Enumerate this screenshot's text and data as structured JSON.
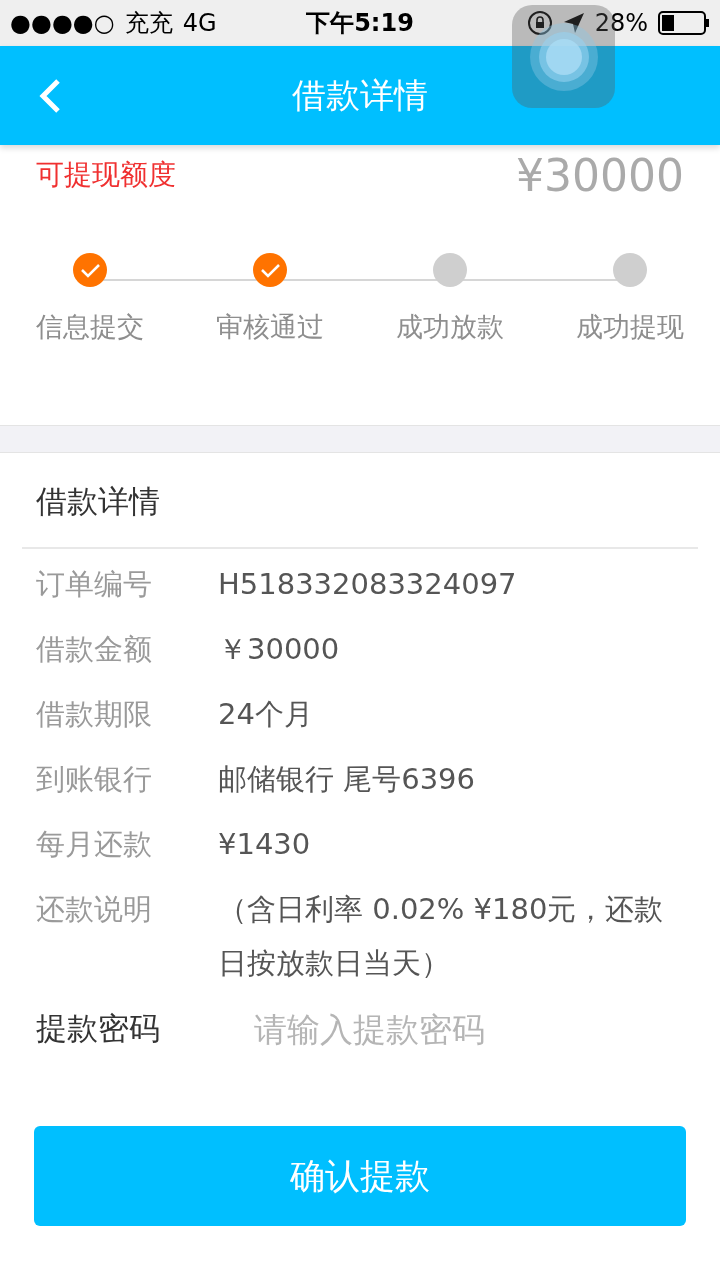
{
  "status_bar": {
    "signal": "●●●●○",
    "carrier": "充充",
    "network": "4G",
    "time": "下午5:19",
    "battery": "28%"
  },
  "header": {
    "title": "借款详情"
  },
  "quota": {
    "label": "可提现额度",
    "amount": "¥30000"
  },
  "steps": [
    {
      "label": "信息提交",
      "done": true
    },
    {
      "label": "审核通过",
      "done": true
    },
    {
      "label": "成功放款",
      "done": false
    },
    {
      "label": "成功提现",
      "done": false
    }
  ],
  "details": {
    "title": "借款详情",
    "rows": [
      {
        "label": "订单编号",
        "value": "H518332083324097"
      },
      {
        "label": "借款金额",
        "value": " ￥30000"
      },
      {
        "label": "借款期限",
        "value": "24个月"
      },
      {
        "label": "到账银行",
        "value": "邮储银行 尾号6396"
      },
      {
        "label": "每月还款",
        "value": "¥1430"
      },
      {
        "label": "还款说明",
        "value": "（含日利率 0.02% ¥180元，还款日按放款日当天）"
      }
    ]
  },
  "password": {
    "label": "提款密码",
    "placeholder": "请输入提款密码"
  },
  "confirm_button": "确认提款"
}
